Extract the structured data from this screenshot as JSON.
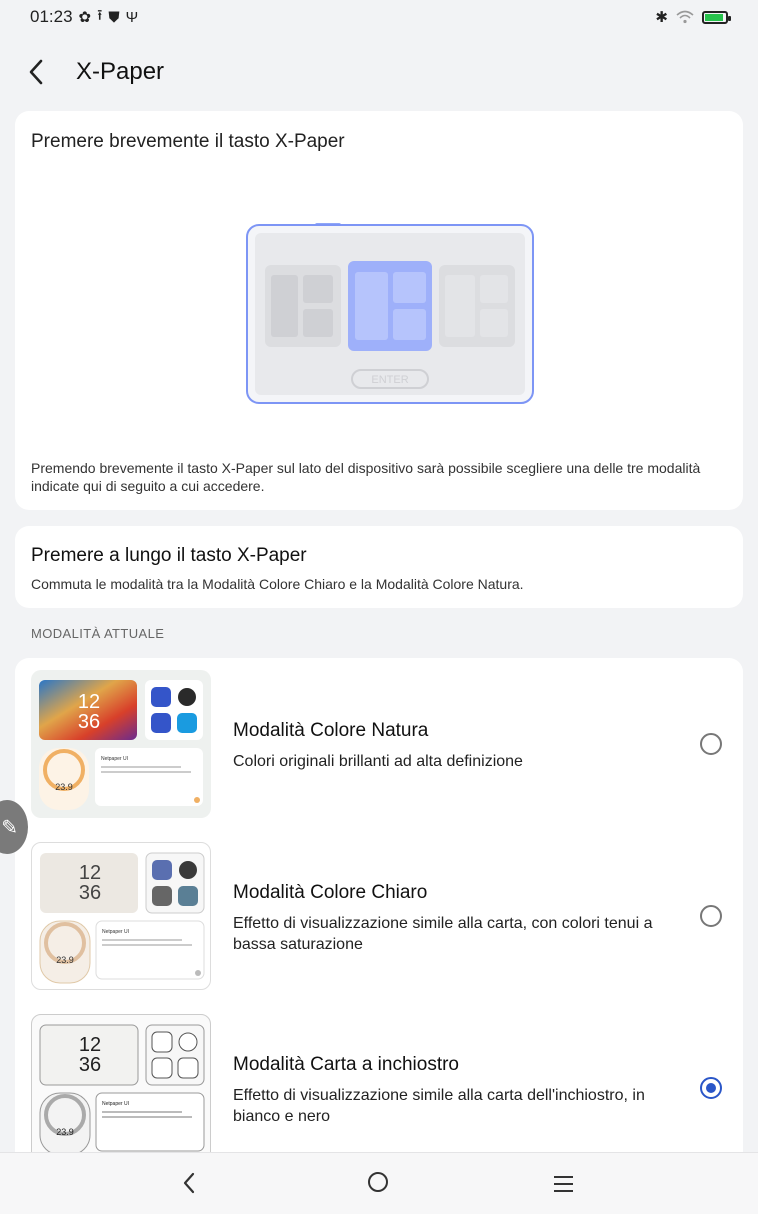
{
  "status": {
    "time": "01:23",
    "left_icons": [
      "gear-icon",
      "upload-icon",
      "shield-icon",
      "usb-icon"
    ],
    "right_icons": [
      "bluetooth-icon",
      "wifi-icon",
      "battery-icon"
    ]
  },
  "header": {
    "title": "X-Paper"
  },
  "short_press": {
    "heading": "Premere brevemente il tasto X-Paper",
    "illustration_button": "ENTER",
    "description": "Premendo brevemente il tasto X-Paper sul lato del dispositivo sarà possibile scegliere una delle tre modalità indicate qui di seguito a cui accedere."
  },
  "long_press": {
    "heading": "Premere a lungo il tasto X-Paper",
    "description": "Commuta le modalità tra la Modalità Colore Chiaro e la Modalità Colore Natura."
  },
  "section_label": "MODALITÀ ATTUALE",
  "thumb_text": {
    "clock_hour": "12",
    "clock_min": "36",
    "temp": "23.9",
    "card_title": "Netpaper UI"
  },
  "modes": [
    {
      "title": "Modalità Colore Natura",
      "description": "Colori originali brillanti ad alta definizione",
      "selected": false
    },
    {
      "title": "Modalità Colore Chiaro",
      "description": "Effetto di visualizzazione simile alla carta, con colori tenui a bassa saturazione",
      "selected": false
    },
    {
      "title": "Modalità Carta a inchiostro",
      "description": "Effetto di visualizzazione simile alla carta dell'inchiostro, in bianco e nero",
      "selected": true
    }
  ],
  "colors": {
    "accent": "#2a56c8",
    "illustration_blue": "#7d95f5",
    "card_bg": "#ffffff",
    "page_bg": "#f2f3f5"
  }
}
